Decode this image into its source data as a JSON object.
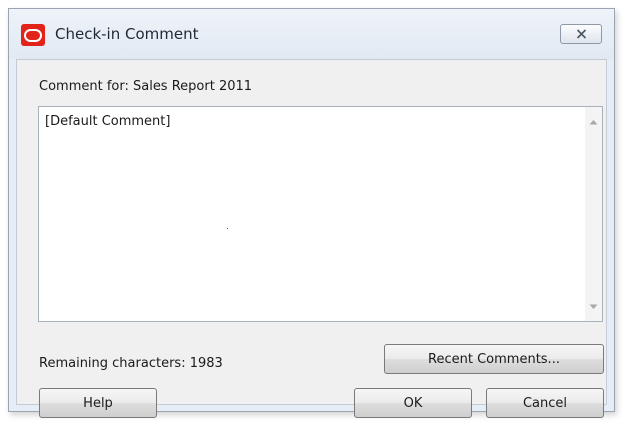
{
  "window": {
    "title": "Check-in Comment",
    "icon": "oracle-logo-icon",
    "close_icon": "close-icon"
  },
  "dialog": {
    "comment_for_label": "Comment for: Sales Report 2011",
    "comment_text": "[Default Comment]",
    "remaining_label": "Remaining characters: 1983"
  },
  "buttons": {
    "recent_comments": "Recent Comments...",
    "help": "Help",
    "ok": "OK",
    "cancel": "Cancel"
  },
  "colors": {
    "brand_red": "#e2231a",
    "title_bar": "#e6edf6",
    "dialog_bg": "#f0f0f0"
  }
}
